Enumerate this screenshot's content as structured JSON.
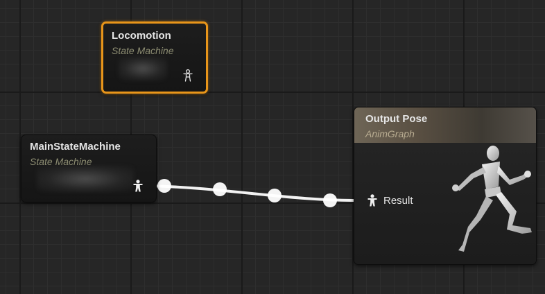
{
  "graph": {
    "background": "#262626",
    "wire_color": "#f2f2f2"
  },
  "nodes": {
    "locomotion": {
      "title": "Locomotion",
      "subtitle": "State Machine",
      "selected": true,
      "outline_color": "#e8951a",
      "pose_pin_icon": "pose-pin-outline-icon"
    },
    "main_state_machine": {
      "title": "MainStateMachine",
      "subtitle": "State Machine",
      "pose_pin_icon": "pose-pin-filled-icon"
    },
    "output_pose": {
      "title": "Output Pose",
      "subtitle": "AnimGraph",
      "header_color": "#6e6556",
      "input_pin": {
        "label": "Result",
        "icon": "pose-pin-filled-icon"
      },
      "illustration": "running-mannequin-icon"
    }
  }
}
